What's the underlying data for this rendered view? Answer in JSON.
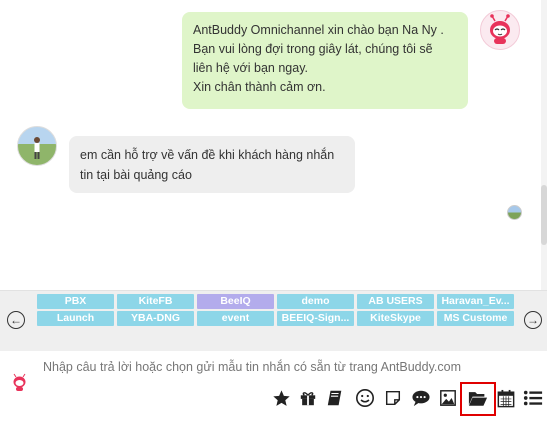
{
  "chat": {
    "outgoing": {
      "lines": [
        "AntBuddy Omnichannel xin chào bạn Na Ny .",
        "Bạn vui lòng đợi trong giây lát, chúng tôi sẽ",
        "liên hệ với bạn ngay.",
        "Xin chân thành cảm ơn."
      ]
    },
    "incoming": {
      "text": "em cần hỗ trợ về vấn đề khi khách hàng nhắn tin tại bài quảng cáo"
    }
  },
  "tags": [
    "PBX",
    "KiteFB",
    "BeeIQ",
    "demo",
    "AB USERS",
    "Haravan_Ev...",
    "Launch",
    "YBA-DNG",
    "event",
    "BEEIQ-Sign...",
    "KiteSkype",
    "MS Custome"
  ],
  "highlighted_tag": "BeeIQ",
  "colors": {
    "tag": "#8dd6e8",
    "tag_highlight": "#b3acec",
    "outgoing_bubble": "#dff5c9",
    "incoming_bubble": "#eeeeee",
    "selection_border": "#e00000"
  },
  "input": {
    "placeholder": "Nhập câu trả lời hoặc chọn gửi mẫu tin nhắn có sẵn từ trang AntBuddy.com"
  },
  "toolbar": [
    "star-icon",
    "gift-icon",
    "book-icon",
    "smiley-icon",
    "note-icon",
    "chat-bubble-icon",
    "image-icon",
    "folder-open-icon",
    "calendar-icon",
    "list-icon"
  ],
  "selected_tool": "folder-open-icon"
}
